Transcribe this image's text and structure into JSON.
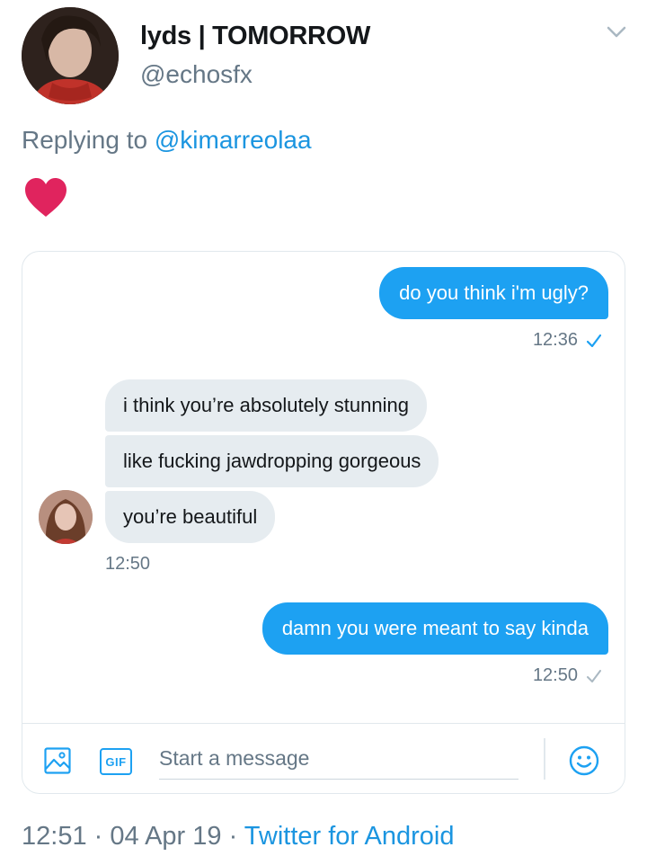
{
  "author": {
    "display_name": "lyds | TOMORROW",
    "handle": "@echosfx"
  },
  "reply": {
    "prefix": "Replying to",
    "mention": "@kimarreolaa"
  },
  "tweet_emoji": "red-heart",
  "dm": {
    "messages": [
      {
        "direction": "out",
        "text": "do you think i'm ugly?"
      },
      {
        "direction": "in",
        "text": "i think you’re absolutely stunning"
      },
      {
        "direction": "in",
        "text": "like fucking jawdropping gorgeous"
      },
      {
        "direction": "in",
        "text": "you’re beautiful"
      },
      {
        "direction": "out",
        "text": "damn you were meant to say kinda"
      }
    ],
    "timestamps": [
      "12:36",
      "12:50",
      "12:50"
    ],
    "read_receipt_colors": {
      "seen": "#1da1f2",
      "sent": "#aab8c2"
    },
    "composer": {
      "gif_label": "GIF",
      "placeholder": "Start a message"
    }
  },
  "footer": {
    "time": "12:51",
    "sep1": " · ",
    "date": "04 Apr 19",
    "sep2": " · ",
    "source": "Twitter for Android"
  },
  "colors": {
    "accent": "#1da1f2",
    "link": "#1b95e0",
    "muted": "#657786",
    "bubble_in": "#e6ecf0",
    "heart": "#e0245e"
  }
}
